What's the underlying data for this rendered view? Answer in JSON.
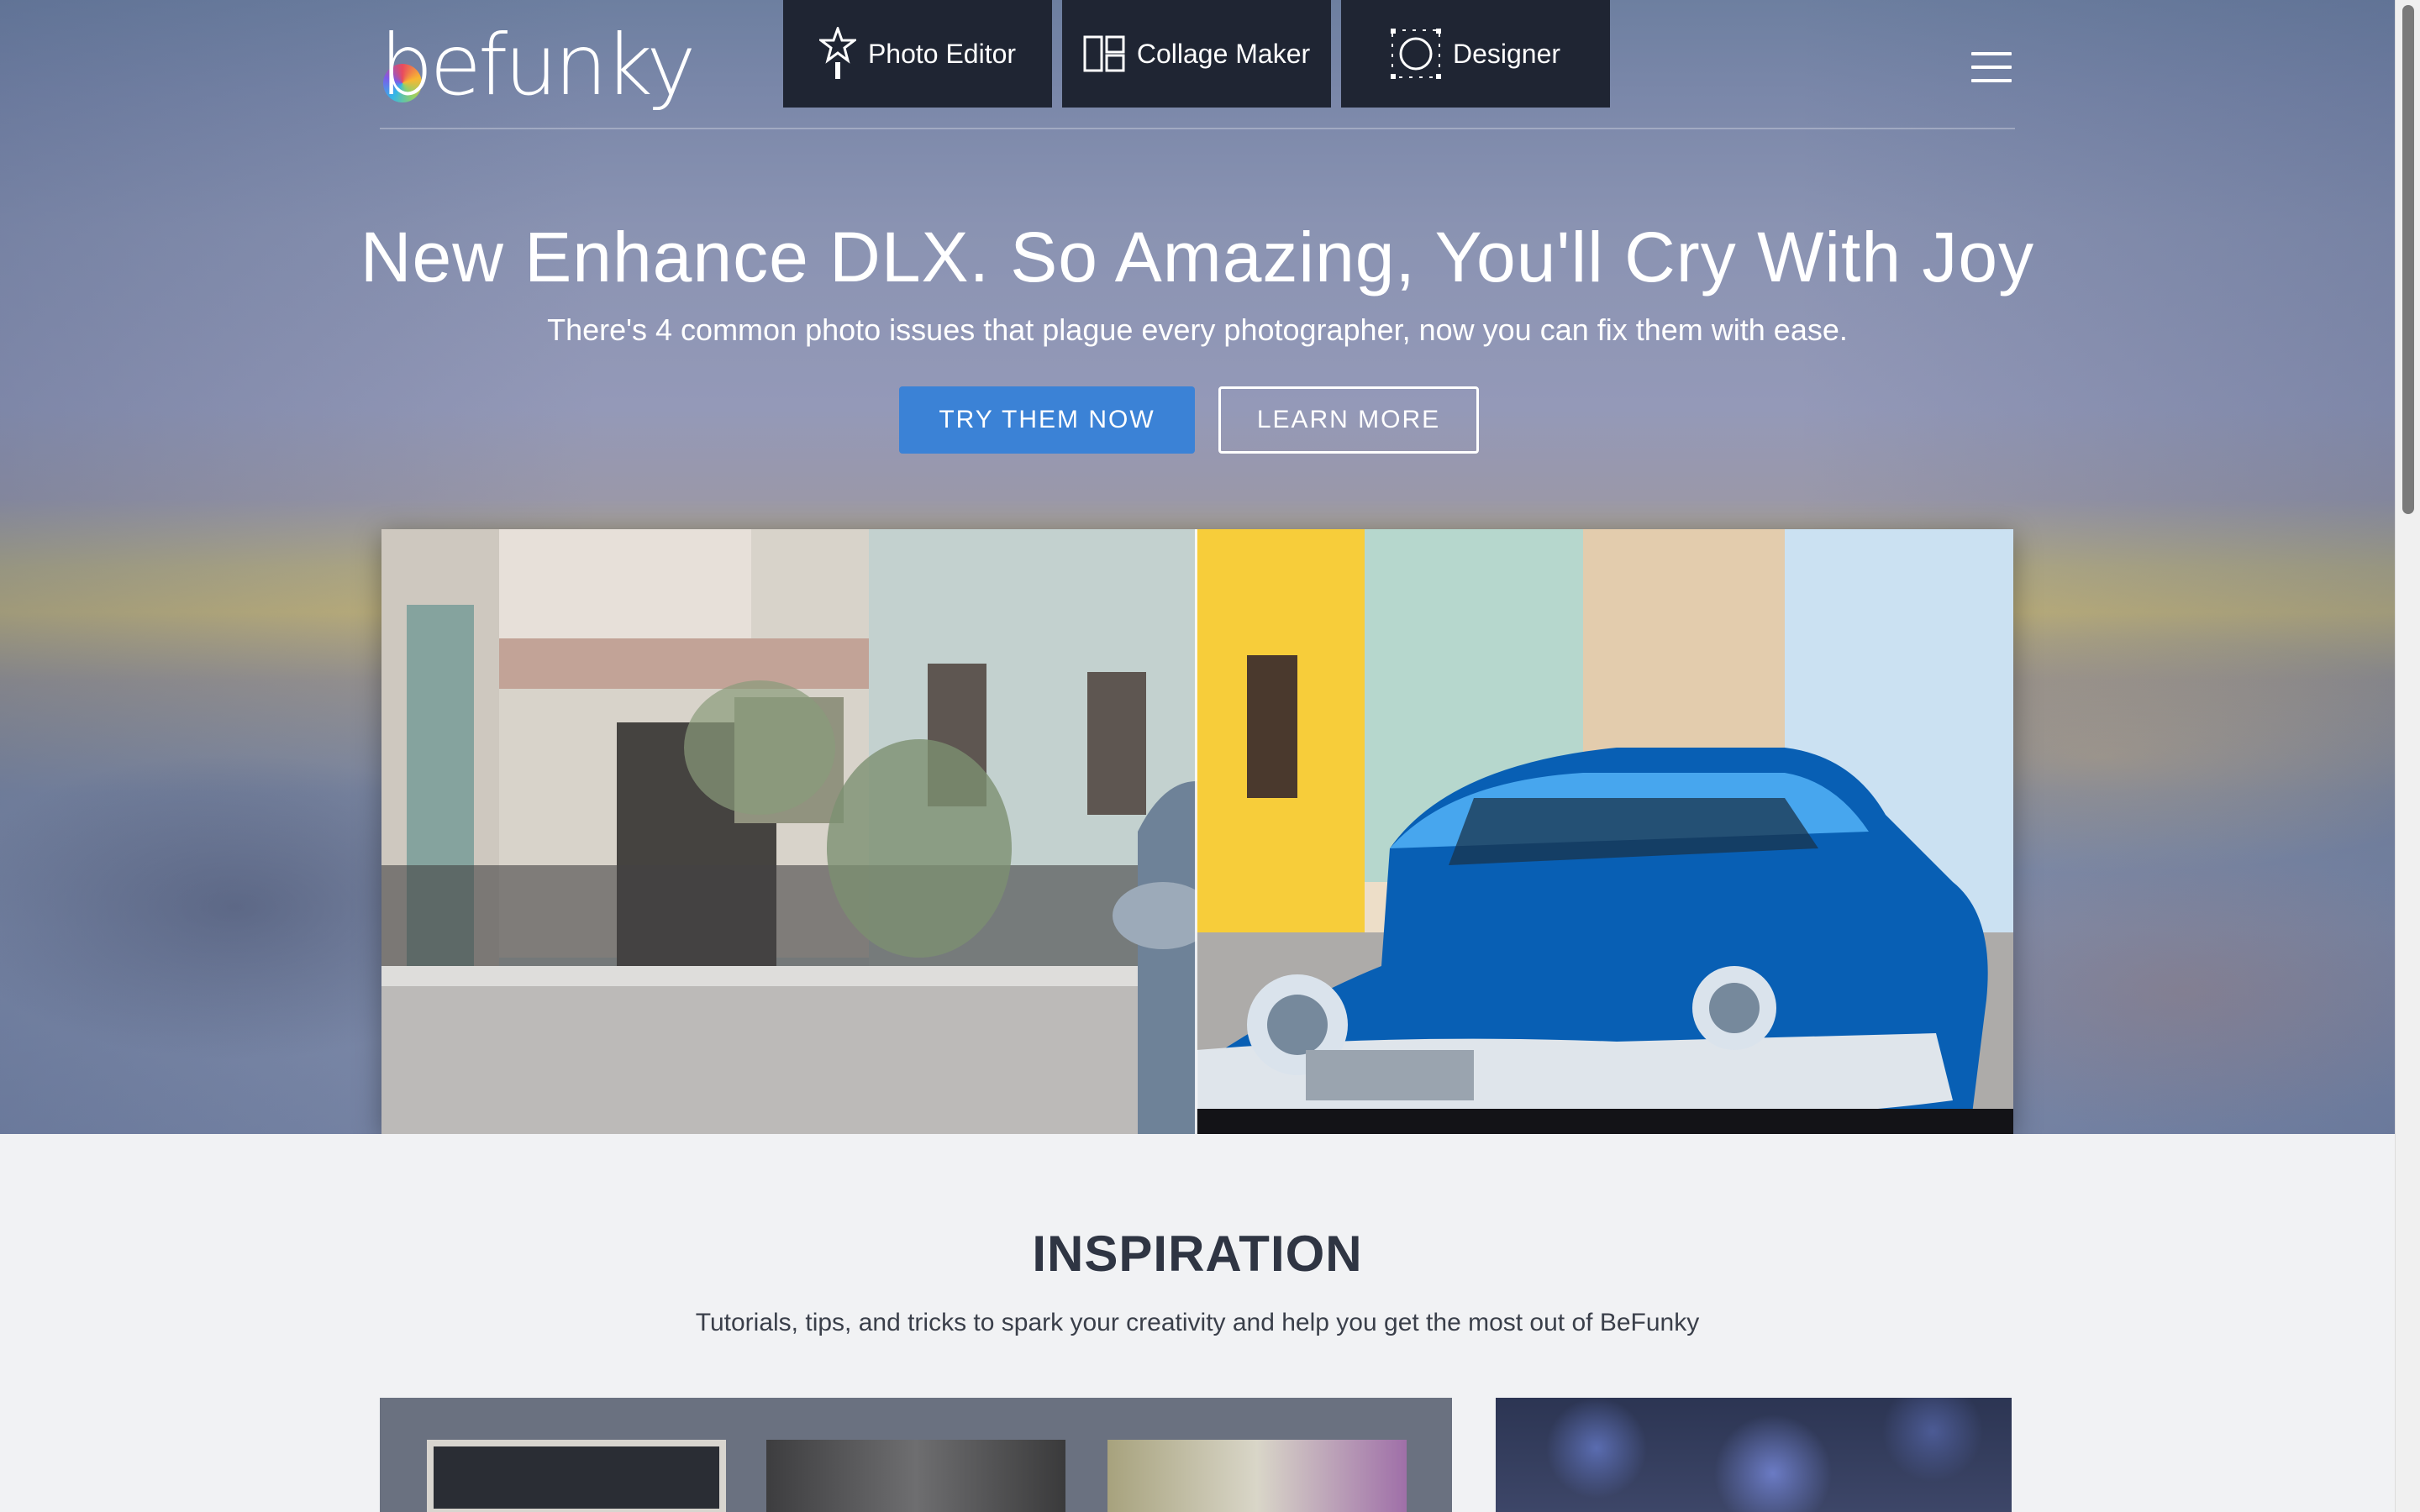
{
  "logo": {
    "text": "befunky"
  },
  "nav": {
    "tabs": [
      {
        "label": "Photo Editor",
        "icon": "star-wand-icon"
      },
      {
        "label": "Collage Maker",
        "icon": "collage-grid-icon"
      },
      {
        "label": "Designer",
        "icon": "designer-circle-icon"
      }
    ],
    "menu_icon": "hamburger-menu-icon"
  },
  "hero": {
    "headline": "New Enhance DLX. So Amazing, You'll Cry With Joy",
    "subhead": "There's 4 common photo issues that plague every photographer, now you can fix them with ease.",
    "primary_button": "TRY THEM NOW",
    "secondary_button": "LEARN MORE"
  },
  "inspiration": {
    "title": "INSPIRATION",
    "subtitle": "Tutorials, tips, and tricks to spark your creativity and help you get the most out of BeFunky"
  },
  "colors": {
    "nav_tab_bg": "#1f2533",
    "primary_button": "#3b82d6",
    "heading_dark": "#2f3543",
    "page_bg": "#f1f2f4"
  }
}
